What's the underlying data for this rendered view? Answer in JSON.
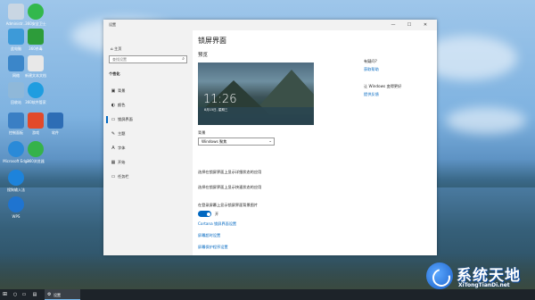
{
  "desktop": {
    "icons": [
      {
        "label": "Administr...",
        "color": "#c9d6e3"
      },
      {
        "label": "360安全卫士",
        "color": "#33b84c"
      },
      {
        "label": "此电脑",
        "color": "#3d9ad8"
      },
      {
        "label": "360杀毒",
        "color": "#2d9c3a"
      },
      {
        "label": "网络",
        "color": "#3b86c9"
      },
      {
        "label": "新建文本文档",
        "color": "#e8e8e8"
      },
      {
        "label": "回收站",
        "color": "#8fb8d9"
      },
      {
        "label": "360软件管家",
        "color": "#1f9de0"
      },
      {
        "label": "控制面板",
        "color": "#3a7fc4"
      },
      {
        "label": "游戏",
        "color": "#e24a2a"
      },
      {
        "label": "软件",
        "color": "#2d6db5"
      },
      {
        "label": "Microsoft Edge",
        "color": "#2a8ad8"
      },
      {
        "label": "360浏览器",
        "color": "#35b24a"
      },
      {
        "label": "搜狗输入法",
        "color": "#1d83db"
      },
      {
        "label": "WPS",
        "color": "#1f74d0"
      }
    ]
  },
  "window": {
    "title": "设置",
    "controls": {
      "minimize": "—",
      "maximize": "☐",
      "close": "✕"
    }
  },
  "sidebar": {
    "home_label": "主页",
    "search_placeholder": "查找设置",
    "section_title": "个性化",
    "items": [
      {
        "icon": "image-icon",
        "glyph": "▣",
        "label": "背景"
      },
      {
        "icon": "palette-icon",
        "glyph": "◐",
        "label": "颜色"
      },
      {
        "icon": "lock-screen-icon",
        "glyph": "▭",
        "label": "锁屏界面"
      },
      {
        "icon": "theme-icon",
        "glyph": "✎",
        "label": "主题"
      },
      {
        "icon": "font-icon",
        "glyph": "A",
        "label": "字体"
      },
      {
        "icon": "start-icon",
        "glyph": "▦",
        "label": "开始"
      },
      {
        "icon": "taskbar-icon",
        "glyph": "▭",
        "label": "任务栏"
      }
    ]
  },
  "main": {
    "title": "锁屏界面",
    "preview_heading": "预览",
    "preview_time": "11:26",
    "preview_date": "8月15日, 星期三",
    "background_label": "背景",
    "background_value": "Windows 聚焦",
    "option1": "选择在锁屏界面上显示详细状态的应用",
    "option2": "选择在锁屏界面上显示快速状态的应用",
    "signin_bg_label": "在登录屏幕上显示锁屏界面背景图片",
    "toggle_state": "开",
    "toggle_on": true,
    "link_cortana": "Cortana 锁屏界面设置",
    "link_timeout": "屏幕超时设置",
    "link_screensaver": "屏幕保护程序设置"
  },
  "aside": {
    "question": "有疑问?",
    "help_link": "获取帮助",
    "improve_title": "让 Windows 变得更好",
    "feedback_link": "提供反馈"
  },
  "taskbar": {
    "settings_label": "设置"
  },
  "watermark": {
    "title": "系统天地",
    "url": "XiTongTianDi.net"
  }
}
